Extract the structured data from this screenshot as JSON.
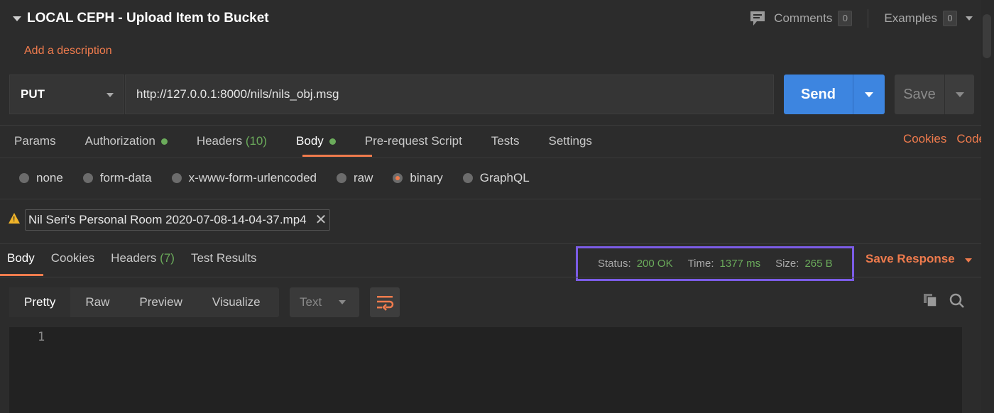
{
  "request": {
    "title": "LOCAL CEPH - Upload Item to Bucket",
    "description_link": "Add a description",
    "comments_label": "Comments",
    "comments_count": "0",
    "examples_label": "Examples",
    "examples_count": "0",
    "method": "PUT",
    "url": "http://127.0.0.1:8000/nils/nils_obj.msg",
    "send_label": "Send",
    "save_label": "Save"
  },
  "request_tabs": {
    "params": "Params",
    "authorization": "Authorization",
    "headers": "Headers",
    "headers_count": "(10)",
    "body": "Body",
    "pre_request": "Pre-request Script",
    "tests": "Tests",
    "settings": "Settings",
    "cookies": "Cookies",
    "code": "Code"
  },
  "body_types": {
    "none": "none",
    "form_data": "form-data",
    "urlencoded": "x-www-form-urlencoded",
    "raw": "raw",
    "binary": "binary",
    "graphql": "GraphQL",
    "selected": "binary"
  },
  "file": {
    "name": "Nil Seri's Personal Room 2020-07-08-14-04-37.mp4"
  },
  "response_tabs": {
    "body": "Body",
    "cookies": "Cookies",
    "headers": "Headers",
    "headers_count": "(7)",
    "test_results": "Test Results"
  },
  "response_meta": {
    "status_label": "Status:",
    "status_value": "200 OK",
    "time_label": "Time:",
    "time_value": "1377 ms",
    "size_label": "Size:",
    "size_value": "265 B",
    "save_response": "Save Response"
  },
  "view": {
    "pretty": "Pretty",
    "raw": "Raw",
    "preview": "Preview",
    "visualize": "Visualize",
    "format": "Text"
  },
  "editor": {
    "line_number": "1"
  },
  "colors": {
    "accent": "#ef7b4d",
    "send": "#3d85e0",
    "success": "#6bab5b",
    "highlight_box": "#7b5ce6"
  }
}
